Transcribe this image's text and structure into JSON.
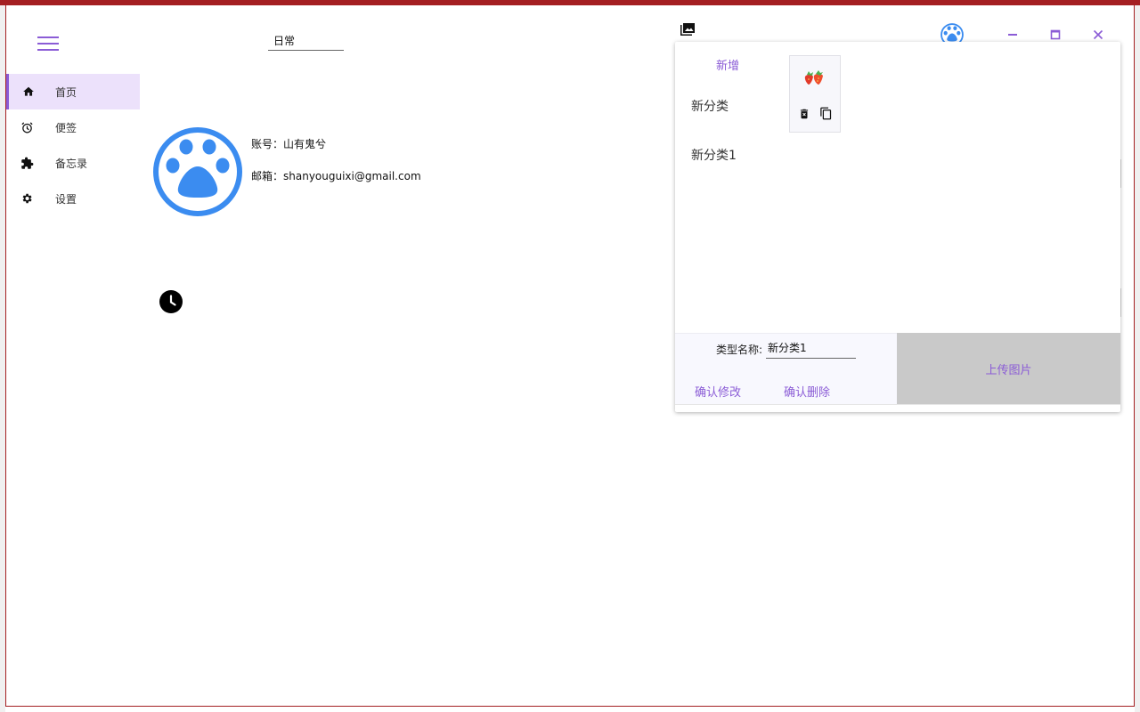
{
  "colors": {
    "accent": "#8b5cd6",
    "frame": "#a41f22",
    "avatar_blue": "#3b8cf0"
  },
  "header": {
    "category_value": "日常"
  },
  "sidebar": {
    "items": [
      {
        "label": "首页",
        "icon": "home-icon",
        "active": true
      },
      {
        "label": "便签",
        "icon": "alarm-icon",
        "active": false
      },
      {
        "label": "备忘录",
        "icon": "puzzle-icon",
        "active": false
      },
      {
        "label": "设置",
        "icon": "gear-icon",
        "active": false
      }
    ]
  },
  "profile": {
    "account": "账号：山有鬼兮",
    "email": "邮箱：shanyouguixi@gmail.com"
  },
  "popup": {
    "add_label": "新增",
    "categories": [
      "新分类",
      "新分类1"
    ],
    "image_card": {
      "thumb_icon": "strawberry-icon"
    },
    "form": {
      "type_label": "类型名称:",
      "type_value": "新分类1",
      "confirm_edit": "确认修改",
      "confirm_delete": "确认删除"
    },
    "upload_label": "上传图片"
  }
}
